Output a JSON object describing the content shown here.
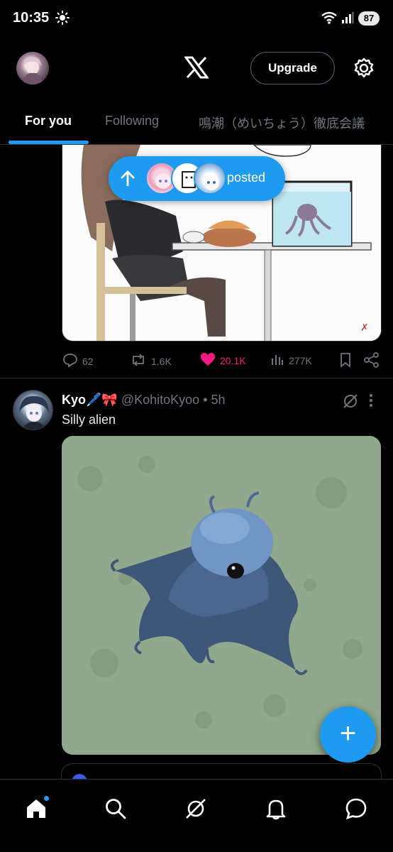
{
  "status_bar": {
    "time": "10:35",
    "battery": "87",
    "icons": [
      "sun-icon",
      "wifi-icon",
      "signal-icon",
      "battery-icon"
    ]
  },
  "header": {
    "logo": "X",
    "upgrade_label": "Upgrade",
    "settings_icon": "gear-icon"
  },
  "tabs": [
    {
      "label": "For you",
      "active": true
    },
    {
      "label": "Following",
      "active": false
    },
    {
      "label": "鳴潮（めいちょう）徹底会議",
      "active": false
    }
  ],
  "posted_pill": {
    "label": "posted",
    "icon": "arrow-up-icon"
  },
  "post1": {
    "metrics": {
      "replies": "62",
      "reposts": "1.6K",
      "likes": "20.1K",
      "views": "277K"
    }
  },
  "post2": {
    "display_name": "Kyo🖊️🎀",
    "handle": "@KohitoKyoo",
    "separator": "•",
    "time": "5h",
    "text": "Silly alien"
  },
  "fab": {
    "label": "+"
  },
  "bottom_nav": [
    {
      "name": "home",
      "icon": "home-icon",
      "active": true
    },
    {
      "name": "search",
      "icon": "search-icon"
    },
    {
      "name": "grok",
      "icon": "grok-icon"
    },
    {
      "name": "notifications",
      "icon": "bell-icon"
    },
    {
      "name": "messages",
      "icon": "message-icon"
    }
  ],
  "colors": {
    "accent": "#1d9bf0",
    "like": "#f91880",
    "muted": "#71767b",
    "background": "#000000"
  }
}
